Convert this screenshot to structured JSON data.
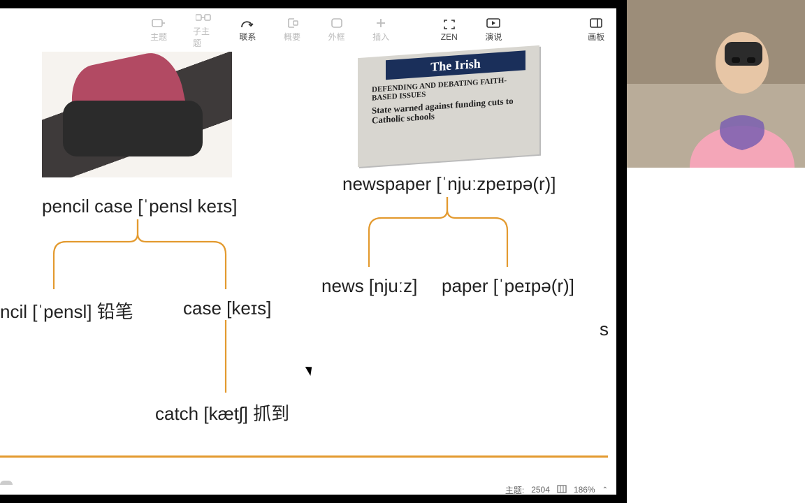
{
  "toolbar": {
    "items": [
      {
        "label": "主题",
        "active": false
      },
      {
        "label": "子主题",
        "active": false
      },
      {
        "label": "联系",
        "active": true
      },
      {
        "label": "概要",
        "active": false
      },
      {
        "label": "外框",
        "active": false
      },
      {
        "label": "插入",
        "active": false
      }
    ],
    "right": [
      {
        "label": "ZEN"
      },
      {
        "label": "演说"
      },
      {
        "label": "画板"
      }
    ]
  },
  "newspaper_image": {
    "masthead": "The Irish",
    "sub1": "DEFENDING AND DEBATING FAITH-BASED ISSUES",
    "sub2": "State warned against funding cuts to Catholic schools"
  },
  "nodes": {
    "pencil_case": "pencil case [ˈpensl keɪs]",
    "pencil": "ncil [ˈpensl] 铅笔",
    "case": "case [keɪs]",
    "catch": "catch [kætʃ] 抓到",
    "newspaper": "newspaper [ˈnjuːzpeɪpə(r)]",
    "news": "news [njuːz]",
    "paper": "paper [ˈpeɪpə(r)]",
    "partial": "s"
  },
  "status": {
    "topics_label": "主题:",
    "topics_count": "2504",
    "zoom": "186%"
  }
}
